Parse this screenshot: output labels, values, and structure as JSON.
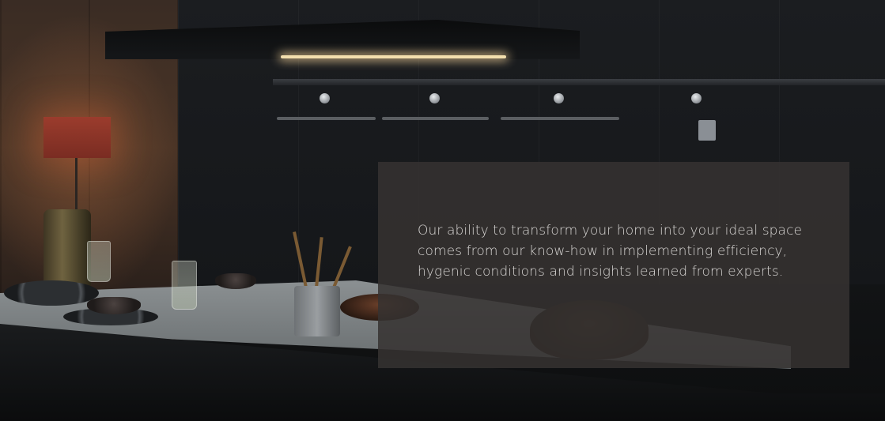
{
  "hero": {
    "description": "Our ability to transform your home into your ideal space comes from our know-how in implementing efficiency, hygenic conditions and insights learned from experts."
  },
  "colors": {
    "card_background": "#363231",
    "card_text": "#d7d5d3",
    "hood_light": "#f3dfae",
    "lamp_shade": "#9b3c2d"
  }
}
